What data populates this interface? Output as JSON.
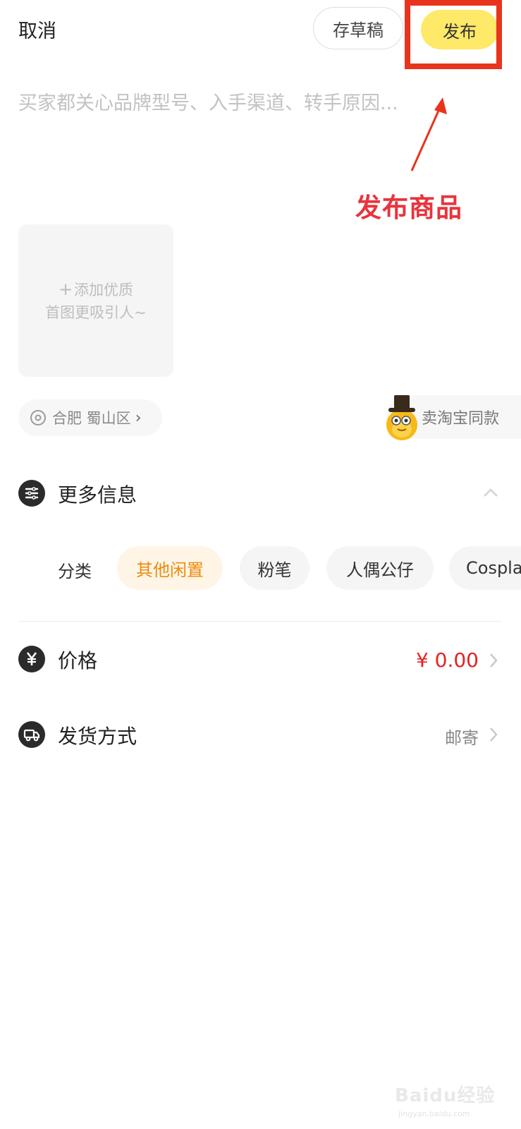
{
  "header": {
    "cancel_label": "取消",
    "draft_label": "存草稿",
    "publish_label": "发布"
  },
  "description": {
    "placeholder": "买家都关心品牌型号、入手渠道、转手原因...",
    "value": ""
  },
  "annotation": {
    "label": "发布商品",
    "color": "#e8341c"
  },
  "image_upload": {
    "plus": "+",
    "line1": "添加优质",
    "line2": "首图更吸引人~"
  },
  "location": {
    "icon": "location-pin-icon",
    "text": "合肥 蜀山区",
    "chevron": "›"
  },
  "taobao": {
    "label": "卖淘宝同款",
    "icon": "mascot-icon"
  },
  "more_info": {
    "icon": "list-icon",
    "title": "更多信息"
  },
  "category": {
    "label": "分类",
    "items": [
      {
        "label": "其他闲置",
        "selected": true
      },
      {
        "label": "粉笔",
        "selected": false
      },
      {
        "label": "人偶公仔",
        "selected": false
      },
      {
        "label": "Cosplay",
        "selected": false
      }
    ]
  },
  "price": {
    "icon": "yen-icon",
    "title": "价格",
    "value": "¥ 0.00"
  },
  "shipping": {
    "icon": "truck-icon",
    "title": "发货方式",
    "value": "邮寄"
  },
  "watermark": {
    "text": "Baidu经验",
    "sub": "jingyan.baidu.com"
  },
  "colors": {
    "accent_yellow": "#fee968",
    "price_red": "#e62222",
    "category_active_text": "#ec8b0c",
    "category_active_bg": "#fff5e6"
  }
}
